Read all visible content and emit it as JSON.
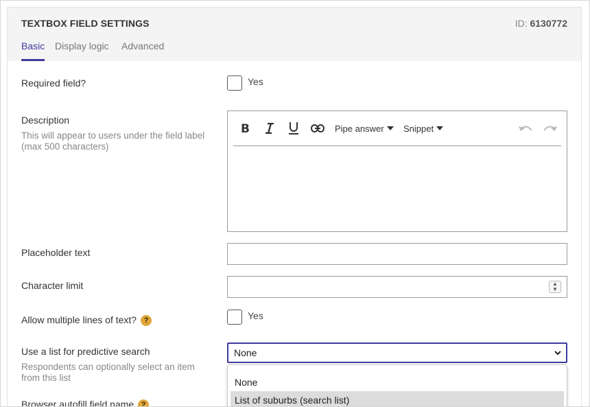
{
  "header": {
    "title": "TEXTBOX FIELD SETTINGS",
    "id_label": "ID:",
    "id_value": "6130772"
  },
  "tabs": [
    {
      "label": "Basic",
      "active": true
    },
    {
      "label": "Display logic",
      "active": false
    },
    {
      "label": "Advanced",
      "active": false
    }
  ],
  "required": {
    "label": "Required field?",
    "option_label": "Yes",
    "checked": false
  },
  "description": {
    "label": "Description",
    "hint": "This will appear to users under the field label (max 500 characters)",
    "toolbar": {
      "bold_icon": "bold-icon",
      "italic_icon": "italic-icon",
      "underline_icon": "underline-icon",
      "link_icon": "link-icon",
      "pipe_answer": "Pipe answer",
      "snippet": "Snippet",
      "undo_icon": "undo-icon",
      "redo_icon": "redo-icon"
    },
    "value": ""
  },
  "placeholder_text": {
    "label": "Placeholder text",
    "value": ""
  },
  "character_limit": {
    "label": "Character limit",
    "value": ""
  },
  "multiline": {
    "label": "Allow multiple lines of text?",
    "help_glyph": "?",
    "option_label": "Yes",
    "checked": false
  },
  "predictive": {
    "label": "Use a list for predictive search",
    "hint": "Respondents can optionally select an item from this list",
    "selected": "None",
    "options": [
      "None",
      "List of suburbs (search list)"
    ],
    "highlighted": "List of suburbs (search list)"
  },
  "autofill": {
    "label": "Browser autofill field name",
    "help_glyph": "?"
  },
  "colors": {
    "accent": "#3f3a9c",
    "help_badge": "#e0a63a",
    "header_bg": "#f4f4f4"
  }
}
